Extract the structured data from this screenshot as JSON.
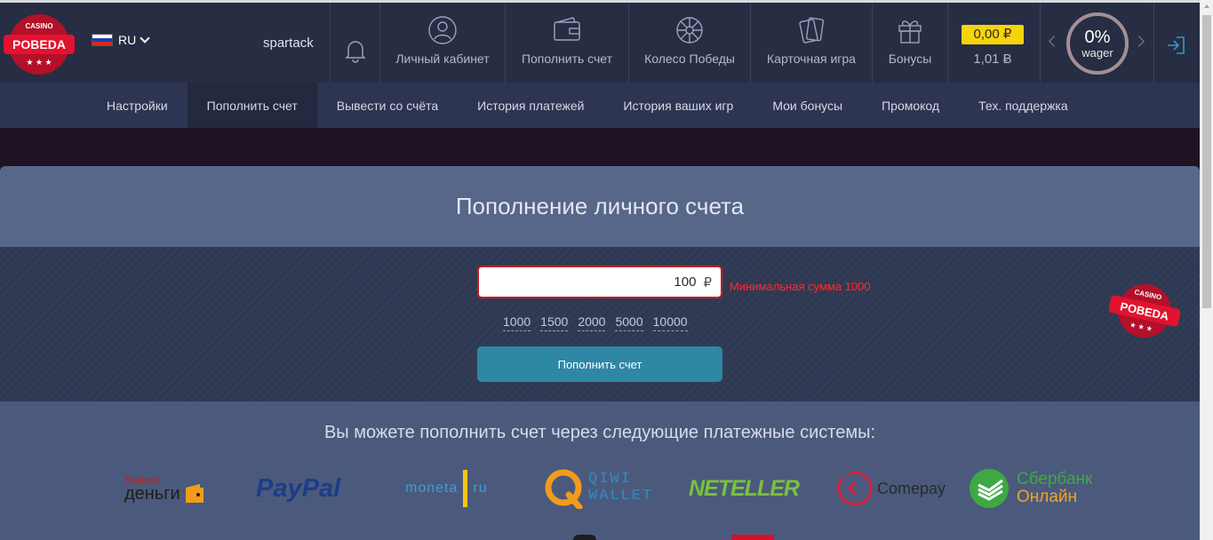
{
  "brand": {
    "top": "CASINO",
    "name": "POBEDA"
  },
  "header": {
    "language": "RU",
    "username": "spartack",
    "nav": [
      {
        "label": "Личный кабинет",
        "icon": "user-icon"
      },
      {
        "label": "Пополнить счет",
        "icon": "wallet-icon"
      },
      {
        "label": "Колесо Победы",
        "icon": "wheel-icon"
      },
      {
        "label": "Карточная игра",
        "icon": "cards-icon"
      },
      {
        "label": "Бонусы",
        "icon": "gift-icon"
      }
    ],
    "balance": "0,00 ₽",
    "bonus_balance": "1,01 Ƀ",
    "wager_percent": "0%",
    "wager_label": "wager"
  },
  "subnav": [
    {
      "label": "Настройки",
      "active": false
    },
    {
      "label": "Пополнить счет",
      "active": true
    },
    {
      "label": "Вывести со счёта",
      "active": false
    },
    {
      "label": "История платежей",
      "active": false
    },
    {
      "label": "История ваших игр",
      "active": false
    },
    {
      "label": "Мои бонусы",
      "active": false
    },
    {
      "label": "Промокод",
      "active": false
    },
    {
      "label": "Тех. поддержка",
      "active": false
    }
  ],
  "deposit": {
    "title": "Пополнение личного счета",
    "amount": "100",
    "currency": "₽",
    "error": "Минимальная сумма 1000",
    "presets": [
      "1000",
      "1500",
      "2000",
      "5000",
      "10000"
    ],
    "submit": "Пополнить счет"
  },
  "payments": {
    "title": "Вы можете пополнить счет через следующие платежные системы:",
    "systems": [
      {
        "line1": "Яндекс",
        "line2": "деньги"
      },
      {
        "name": "PayPal"
      },
      {
        "left": "moneta",
        "right": "ru"
      },
      {
        "line1": "QIWI",
        "line2": "WALLET"
      },
      {
        "name": "NETELLER"
      },
      {
        "name": "Comepay"
      },
      {
        "line1": "Сбербанк",
        "line2": "Онлайн"
      }
    ]
  },
  "colors": {
    "accent": "#2e87a5",
    "balance": "#f4d40c",
    "error": "#ff2a2a",
    "brand": "#d4102b"
  }
}
